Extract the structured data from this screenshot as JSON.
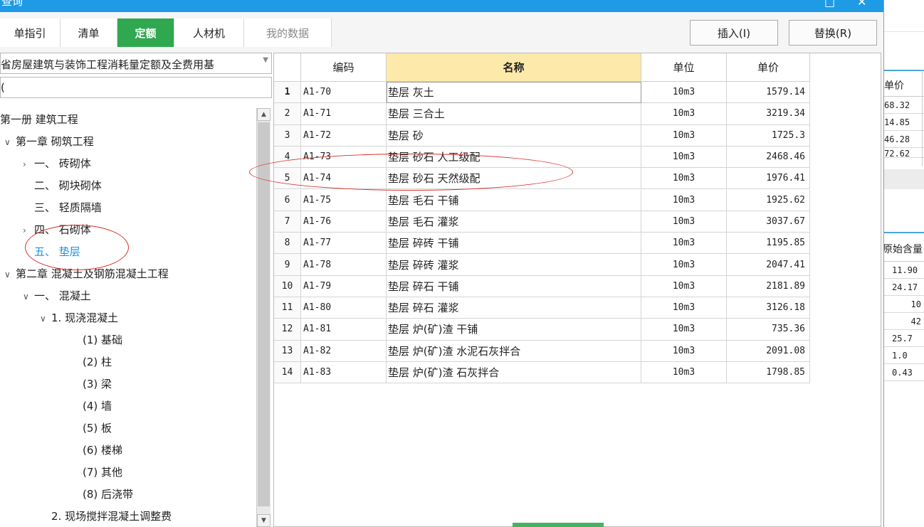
{
  "window": {
    "title": "查询"
  },
  "tabs": [
    {
      "label": "单指引",
      "state": "normal"
    },
    {
      "label": "清单",
      "state": "normal"
    },
    {
      "label": "定额",
      "state": "active"
    },
    {
      "label": "人材机",
      "state": "normal"
    },
    {
      "label": "我的数据",
      "state": "disabled"
    }
  ],
  "toolbar": {
    "insert_label": "插入(I)",
    "replace_label": "替换(R)"
  },
  "left": {
    "library": "省房屋建筑与装饰工程消耗量定额及全费用基",
    "search_value": "(",
    "tree": [
      {
        "label": "第一册 建筑工程",
        "level": 0,
        "chevron": ""
      },
      {
        "label": "第一章 砌筑工程",
        "level": 1,
        "chevron": "down"
      },
      {
        "label": "一、 砖砌体",
        "level": 2,
        "chevron": "right"
      },
      {
        "label": "二、 砌块砌体",
        "level": 2,
        "chevron": ""
      },
      {
        "label": "三、 轻质隔墙",
        "level": 2,
        "chevron": ""
      },
      {
        "label": "四、 石砌体",
        "level": 2,
        "chevron": "right"
      },
      {
        "label": "五、 垫层",
        "level": 2,
        "chevron": "",
        "selected": true
      },
      {
        "label": "第二章 混凝土及钢筋混凝土工程",
        "level": 1,
        "chevron": "down"
      },
      {
        "label": "一、 混凝土",
        "level": 2,
        "chevron": "down"
      },
      {
        "label": "1. 现浇混凝土",
        "level": 3,
        "chevron": "down"
      },
      {
        "label": "(1) 基础",
        "level": 4,
        "chevron": ""
      },
      {
        "label": "(2) 柱",
        "level": 4,
        "chevron": ""
      },
      {
        "label": "(3) 梁",
        "level": 4,
        "chevron": ""
      },
      {
        "label": "(4) 墙",
        "level": 4,
        "chevron": ""
      },
      {
        "label": "(5) 板",
        "level": 4,
        "chevron": ""
      },
      {
        "label": "(6) 楼梯",
        "level": 4,
        "chevron": ""
      },
      {
        "label": "(7) 其他",
        "level": 4,
        "chevron": ""
      },
      {
        "label": "(8) 后浇带",
        "level": 4,
        "chevron": ""
      },
      {
        "label": "2. 现场搅拌混凝土调整费",
        "level": 3,
        "chevron": ""
      }
    ]
  },
  "grid": {
    "headers": {
      "code": "编码",
      "name": "名称",
      "unit": "单位",
      "price": "单价"
    },
    "rows": [
      {
        "no": "1",
        "code": "A1-70",
        "name": "垫层 灰土",
        "unit": "10m3",
        "price": "1579.14"
      },
      {
        "no": "2",
        "code": "A1-71",
        "name": "垫层 三合土",
        "unit": "10m3",
        "price": "3219.34"
      },
      {
        "no": "3",
        "code": "A1-72",
        "name": "垫层 砂",
        "unit": "10m3",
        "price": "1725.3"
      },
      {
        "no": "4",
        "code": "A1-73",
        "name": "垫层 砂石 人工级配",
        "unit": "10m3",
        "price": "2468.46"
      },
      {
        "no": "5",
        "code": "A1-74",
        "name": "垫层 砂石 天然级配",
        "unit": "10m3",
        "price": "1976.41"
      },
      {
        "no": "6",
        "code": "A1-75",
        "name": "垫层 毛石 干铺",
        "unit": "10m3",
        "price": "1925.62"
      },
      {
        "no": "7",
        "code": "A1-76",
        "name": "垫层 毛石 灌浆",
        "unit": "10m3",
        "price": "3037.67"
      },
      {
        "no": "8",
        "code": "A1-77",
        "name": "垫层 碎砖 干铺",
        "unit": "10m3",
        "price": "1195.85"
      },
      {
        "no": "9",
        "code": "A1-78",
        "name": "垫层 碎砖 灌浆",
        "unit": "10m3",
        "price": "2047.41"
      },
      {
        "no": "10",
        "code": "A1-79",
        "name": "垫层 碎石 干铺",
        "unit": "10m3",
        "price": "2181.89"
      },
      {
        "no": "11",
        "code": "A1-80",
        "name": "垫层 碎石 灌浆",
        "unit": "10m3",
        "price": "3126.18"
      },
      {
        "no": "12",
        "code": "A1-81",
        "name": "垫层 炉(矿)渣 干铺",
        "unit": "10m3",
        "price": "735.36"
      },
      {
        "no": "13",
        "code": "A1-82",
        "name": "垫层 炉(矿)渣 水泥石灰拌合",
        "unit": "10m3",
        "price": "2091.08"
      },
      {
        "no": "14",
        "code": "A1-83",
        "name": "垫层 炉(矿)渣 石灰拌合",
        "unit": "10m3",
        "price": "1798.85"
      }
    ]
  },
  "background": {
    "grid1_header": "单价",
    "grid1_values": [
      "68.32",
      "14.85",
      "46.28",
      "72.62"
    ],
    "grid2_header": "原始含量",
    "grid2_values": [
      "11.90",
      "24.17",
      "10",
      "42",
      "25.7",
      "1.0",
      "0.43"
    ]
  },
  "colors": {
    "titlebar": "#1f9be6",
    "active_tab": "#2fa84f",
    "name_header": "#fde9a9",
    "selected_tree": "#1f8fe0",
    "annotation": "#d9302a"
  }
}
